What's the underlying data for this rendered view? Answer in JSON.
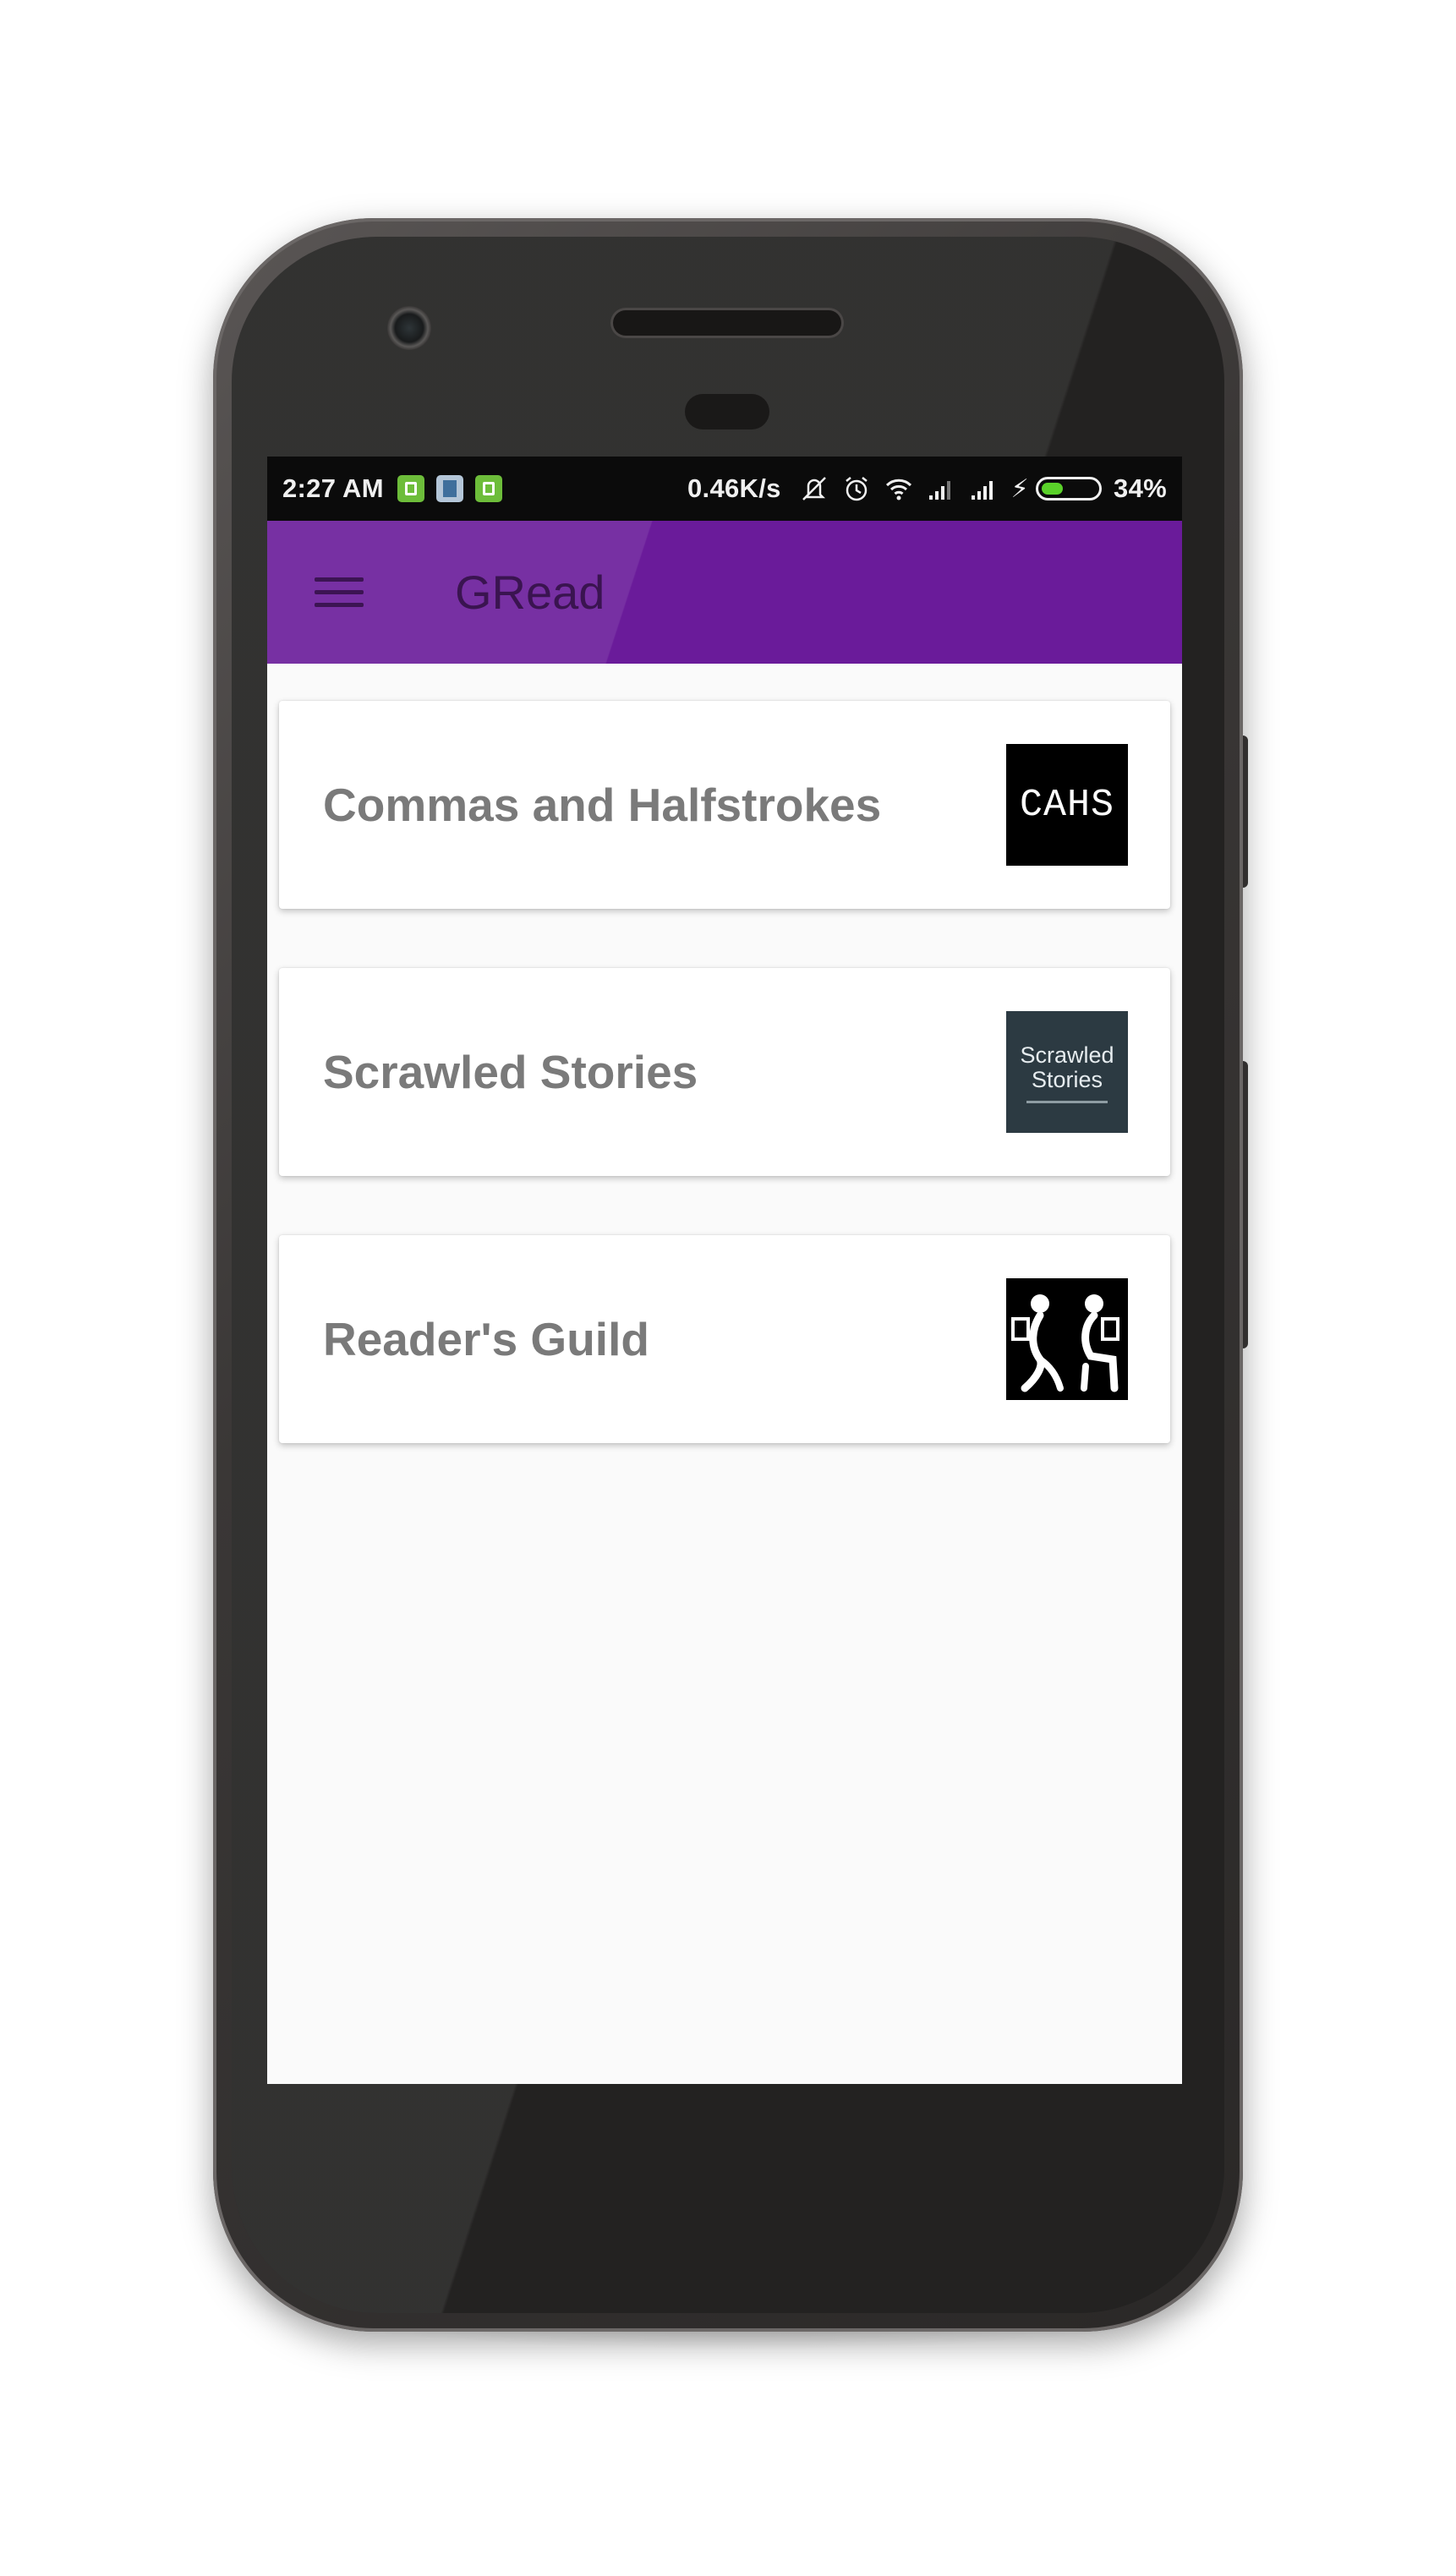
{
  "status_bar": {
    "time": "2:27 AM",
    "network_speed": "0.46K/s",
    "battery_percent": "34%",
    "battery_level": 0.34,
    "icons": [
      "sim-notification-icon",
      "file-notification-icon",
      "android-notification-icon",
      "vibrate-icon",
      "alarm-icon",
      "wifi-icon",
      "signal-icon",
      "signal-icon",
      "charging-icon",
      "battery-icon"
    ]
  },
  "app_bar": {
    "title": "GRead",
    "menu_icon": "hamburger-menu-icon",
    "color": "#6a1b9a"
  },
  "groups": [
    {
      "title": "Commas and Halfstrokes",
      "thumb_text": "CAHS"
    },
    {
      "title": "Scrawled Stories",
      "thumb_text": "Scrawled Stories"
    },
    {
      "title": "Reader's Guild",
      "thumb_text": ""
    }
  ],
  "colors": {
    "status_bar_bg": "#0b0b0b",
    "app_bar_bg": "#6a1b9a",
    "card_title": "#7a7a7a",
    "screen_bg": "#fafafa"
  }
}
